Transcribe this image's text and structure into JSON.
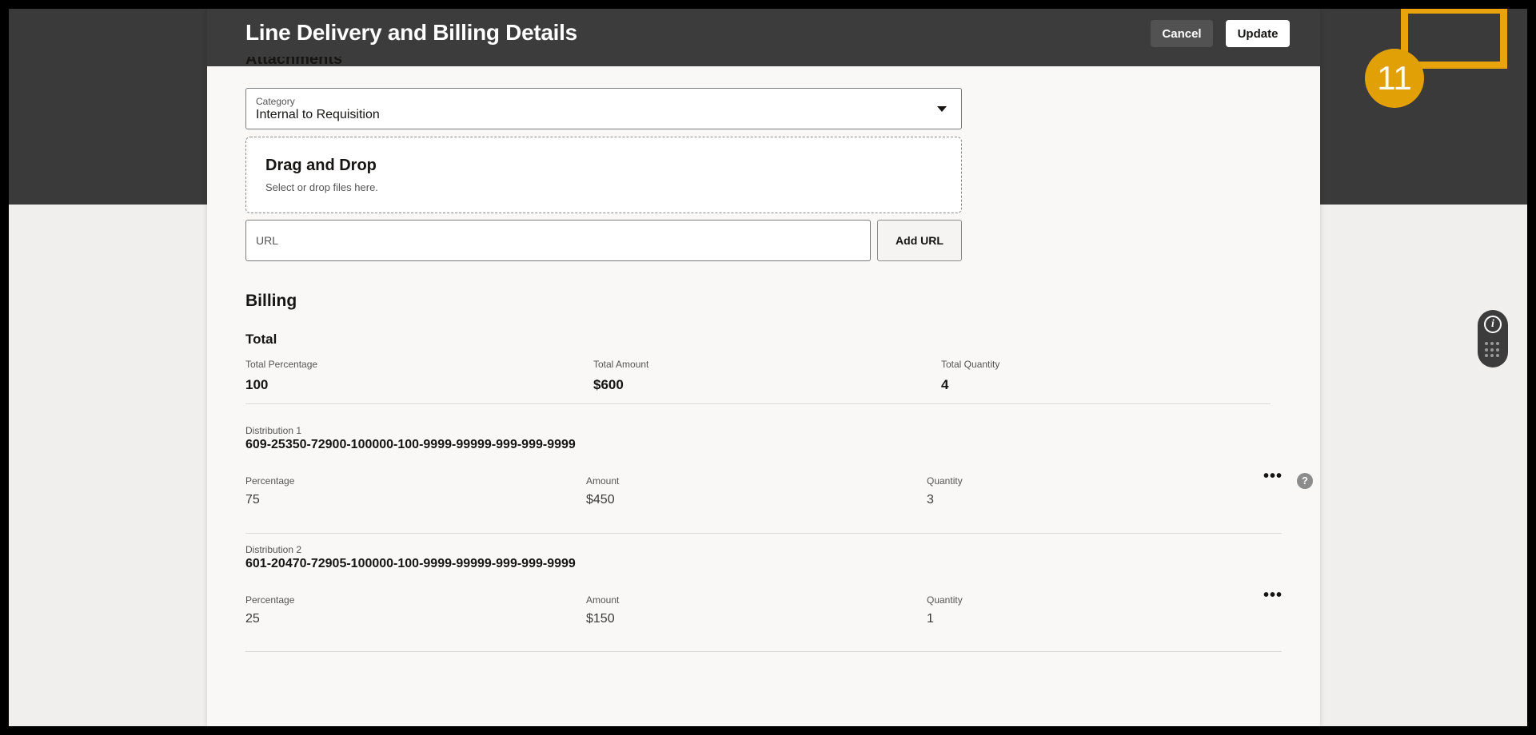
{
  "header": {
    "title": "Line Delivery and Billing Details",
    "cancel_label": "Cancel",
    "update_label": "Update"
  },
  "tutorial": {
    "step_number": "11",
    "highlight_color": "#e8a40a"
  },
  "attachments": {
    "heading": "Attachments",
    "category": {
      "label": "Category",
      "value": "Internal to Requisition"
    },
    "dropzone": {
      "title": "Drag and Drop",
      "subtitle": "Select or drop files here."
    },
    "url": {
      "placeholder": "URL",
      "value": ""
    },
    "add_url_label": "Add URL"
  },
  "billing": {
    "heading": "Billing",
    "total": {
      "heading": "Total",
      "percentage_label": "Total Percentage",
      "percentage": "100",
      "amount_label": "Total Amount",
      "amount": "$600",
      "quantity_label": "Total Quantity",
      "quantity": "4"
    },
    "distributions": [
      {
        "label": "Distribution 1",
        "account": "609-25350-72900-100000-100-9999-99999-999-999-9999",
        "percentage_label": "Percentage",
        "percentage": "75",
        "amount_label": "Amount",
        "amount": "$450",
        "quantity_label": "Quantity",
        "quantity": "3"
      },
      {
        "label": "Distribution 2",
        "account": "601-20470-72905-100000-100-9999-99999-999-999-9999",
        "percentage_label": "Percentage",
        "percentage": "25",
        "amount_label": "Amount",
        "amount": "$150",
        "quantity_label": "Quantity",
        "quantity": "1"
      }
    ]
  },
  "icons": {
    "more": "more-actions-icon",
    "help": "help-icon",
    "help_glyph": "?",
    "info_glyph": "i",
    "dropdown": "chevron-down-icon"
  }
}
